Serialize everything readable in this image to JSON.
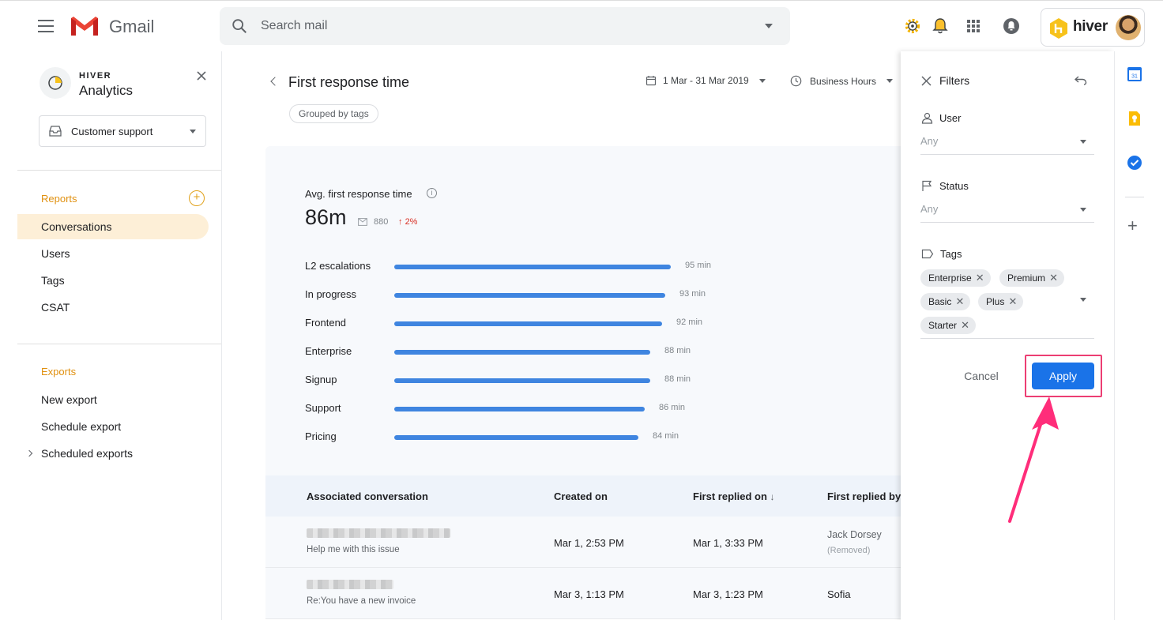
{
  "topbar": {
    "app_name": "Gmail",
    "search_placeholder": "Search mail",
    "hiver_label": "hiver"
  },
  "sidebar": {
    "brand_small": "HIVER",
    "brand_big": "Analytics",
    "inbox_select": "Customer support",
    "reports_heading": "Reports",
    "reports_items": [
      {
        "label": "Conversations",
        "active": true
      },
      {
        "label": "Users"
      },
      {
        "label": "Tags"
      },
      {
        "label": "CSAT"
      }
    ],
    "exports_heading": "Exports",
    "exports_items": [
      {
        "label": "New export"
      },
      {
        "label": "Schedule export"
      },
      {
        "label": "Scheduled exports"
      }
    ]
  },
  "report": {
    "title": "First response time",
    "grouped_chip": "Grouped by tags",
    "date_range": "1 Mar - 31 Mar 2019",
    "hours_filter": "Business Hours",
    "avg_label": "Avg. first response time",
    "avg_value": "86m",
    "count": "880",
    "delta": "2%",
    "bars": [
      {
        "label": "L2 escalations",
        "value": 95,
        "value_text": "95 min"
      },
      {
        "label": "In progress",
        "value": 93,
        "value_text": "93 min"
      },
      {
        "label": "Frontend",
        "value": 92,
        "value_text": "92 min"
      },
      {
        "label": "Enterprise",
        "value": 88,
        "value_text": "88 min"
      },
      {
        "label": "Signup",
        "value": 88,
        "value_text": "88 min"
      },
      {
        "label": "Support",
        "value": 86,
        "value_text": "86 min"
      },
      {
        "label": "Pricing",
        "value": 84,
        "value_text": "84 min"
      }
    ]
  },
  "table": {
    "headers": [
      "Associated conversation",
      "Created on",
      "First replied on",
      "First replied by"
    ],
    "sort_indicator": "↓",
    "rows": [
      {
        "subject": "Help me with this issue",
        "created": "Mar 1, 2:53 PM",
        "first_replied": "Mar 1, 3:33 PM",
        "replied_by": "Jack Dorsey",
        "replied_by_note": "(Removed)"
      },
      {
        "subject": "Re:You have a new invoice",
        "created": "Mar 3, 1:13 PM",
        "first_replied": "Mar 3, 1:23 PM",
        "replied_by": "Sofia",
        "replied_by_note": ""
      }
    ]
  },
  "filters": {
    "title": "Filters",
    "user_label": "User",
    "user_value": "Any",
    "status_label": "Status",
    "status_value": "Any",
    "tags_label": "Tags",
    "tags": [
      "Enterprise",
      "Premium",
      "Basic",
      "Plus",
      "Starter"
    ],
    "cancel_label": "Cancel",
    "apply_label": "Apply"
  },
  "colors": {
    "accent_orange": "#e0900f",
    "bar_blue": "#3f85e0",
    "apply_blue": "#1a73e8",
    "annotation_pink": "#ec3e73",
    "delta_red": "#d93025"
  },
  "icons": {
    "top_right": [
      "settings-gear-icon",
      "notification-bell-icon",
      "apps-grid-icon",
      "account-notification-icon"
    ],
    "rail": [
      "calendar-icon",
      "keep-icon",
      "tasks-icon",
      "add-icon"
    ]
  }
}
